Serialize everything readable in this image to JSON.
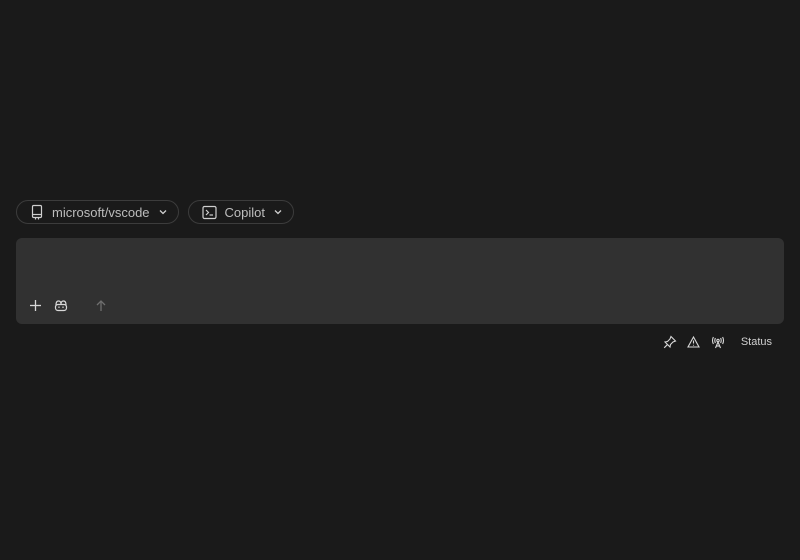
{
  "repo_selector": {
    "label": "microsoft/vscode",
    "icon": "repo-icon"
  },
  "agent_selector": {
    "label": "Copilot",
    "icon": "terminal-icon"
  },
  "composer": {
    "placeholder": "",
    "add_icon": "plus-icon",
    "copilot_icon": "copilot-icon",
    "send_icon": "arrow-up-icon"
  },
  "status_bar": {
    "icons": [
      "pin-icon",
      "warning-icon",
      "broadcast-icon"
    ],
    "status_label": "Status"
  },
  "colors": {
    "background": "#1a1a1a",
    "composer_bg": "#313131",
    "chip_border": "#3c3c3c",
    "text": "#cccccc"
  }
}
